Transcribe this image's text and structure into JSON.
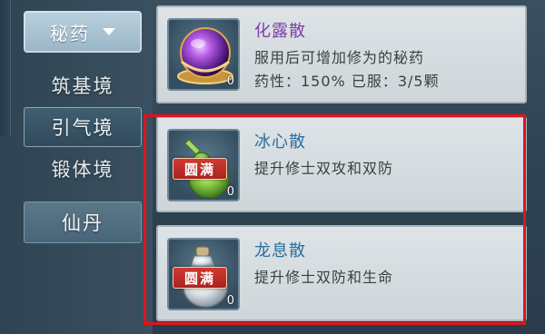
{
  "sidebar": {
    "dropdown_label": "秘药",
    "categories": [
      "筑基境",
      "引气境",
      "锻体境"
    ],
    "extra_category": "仙丹"
  },
  "items": [
    {
      "name": "化露散",
      "name_color": "#7a3fa8",
      "desc_line1": "服用后可增加修为的秘药",
      "desc_line2": "药性：150% 已服：3/5颗",
      "count": "0",
      "icon": "purple-orb-icon"
    },
    {
      "name": "冰心散",
      "name_color": "#2a6f9e",
      "desc_line1": "提升修士双攻和双防",
      "badge": "圆满",
      "count": "0",
      "icon": "green-gourd-icon"
    },
    {
      "name": "龙息散",
      "name_color": "#2a6f9e",
      "desc_line1": "提升修士双防和生命",
      "badge": "圆满",
      "count": "0",
      "icon": "white-bottle-icon"
    }
  ],
  "colors": {
    "highlight_border": "#e0141b",
    "badge_red": "#c02e28"
  }
}
